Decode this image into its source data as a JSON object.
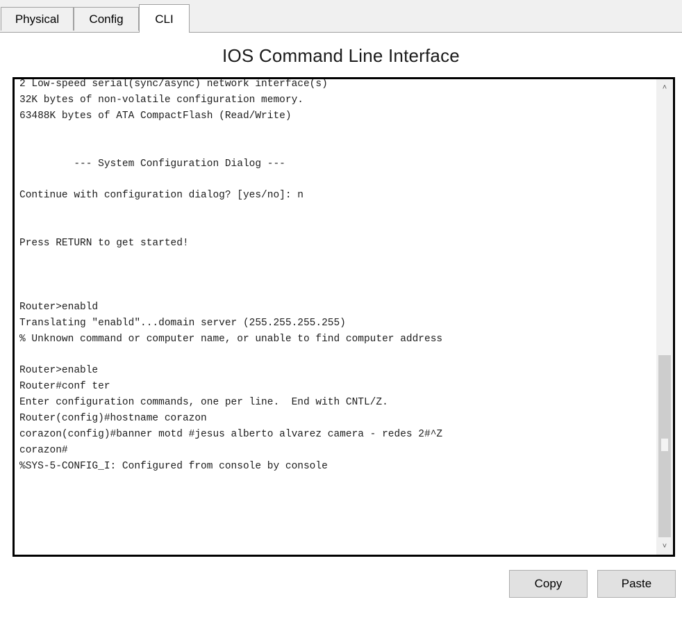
{
  "tabs": [
    {
      "label": "Physical",
      "active": false
    },
    {
      "label": "Config",
      "active": false
    },
    {
      "label": "CLI",
      "active": true
    }
  ],
  "heading": "IOS Command Line Interface",
  "terminal": {
    "lines": [
      "2 Low-speed serial(sync/async) network interface(s)",
      "32K bytes of non-volatile configuration memory.",
      "63488K bytes of ATA CompactFlash (Read/Write)",
      "",
      "",
      "         --- System Configuration Dialog ---",
      "",
      "Continue with configuration dialog? [yes/no]: n",
      "",
      "",
      "Press RETURN to get started!",
      "",
      "",
      "",
      "Router>enabld",
      "Translating \"enabld\"...domain server (255.255.255.255)",
      "% Unknown command or computer name, or unable to find computer address",
      "",
      "Router>enable",
      "Router#conf ter",
      "Enter configuration commands, one per line.  End with CNTL/Z.",
      "Router(config)#hostname corazon",
      "corazon(config)#banner motd #jesus alberto alvarez camera - redes 2#^Z",
      "corazon#",
      "%SYS-5-CONFIG_I: Configured from console by console"
    ],
    "scroll_up_icon": "chevron-up-icon",
    "scroll_down_icon": "chevron-down-icon"
  },
  "buttons": {
    "copy_label": "Copy",
    "paste_label": "Paste"
  },
  "colors": {
    "tab_background": "#f0f0f0",
    "terminal_border": "#000000",
    "button_background": "#e1e1e1"
  }
}
